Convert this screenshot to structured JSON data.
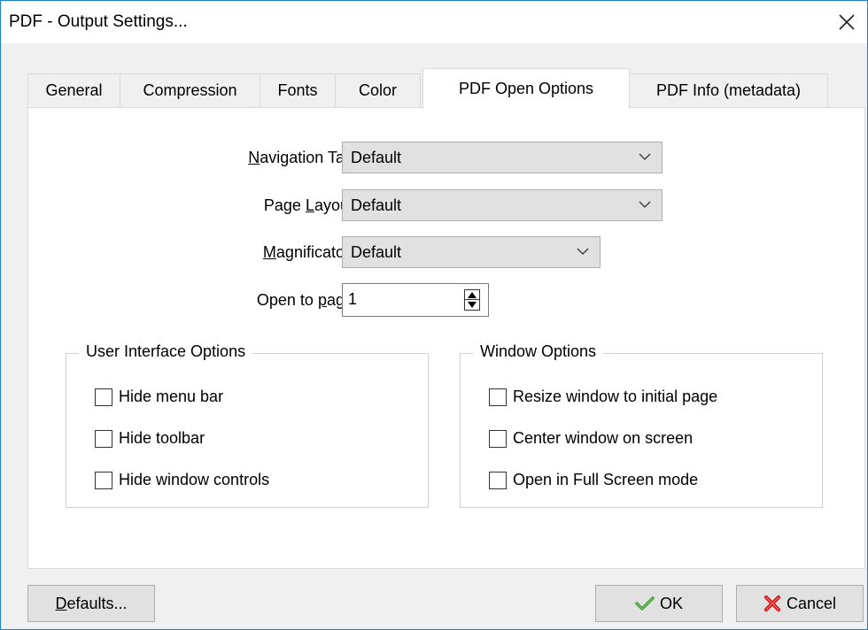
{
  "window": {
    "title": "PDF - Output Settings..."
  },
  "tabs": [
    {
      "label": "General"
    },
    {
      "label": "Compression"
    },
    {
      "label": "Fonts"
    },
    {
      "label": "Color"
    },
    {
      "label": "PDF Open Options",
      "active": true
    },
    {
      "label": "PDF Info (metadata)"
    }
  ],
  "form": {
    "navigation_tab": {
      "label_pre": "",
      "label_u": "N",
      "label_post": "avigation Tab:",
      "value": "Default"
    },
    "page_layout": {
      "label_pre": "Page ",
      "label_u": "L",
      "label_post": "ayout:",
      "value": "Default"
    },
    "magnification": {
      "label_pre": "",
      "label_u": "M",
      "label_post": "agnificaton:",
      "value": "Default"
    },
    "open_to_page": {
      "label_pre": "Open to ",
      "label_u": "p",
      "label_post": "age:",
      "value": "1"
    }
  },
  "ui_options": {
    "title": "User Interface Options",
    "items": [
      {
        "label": "Hide menu bar",
        "checked": false
      },
      {
        "label": "Hide toolbar",
        "checked": false
      },
      {
        "label": "Hide window controls",
        "checked": false
      }
    ]
  },
  "window_options": {
    "title": "Window Options",
    "items": [
      {
        "label": "Resize window to initial page",
        "checked": false
      },
      {
        "label": "Center window on screen",
        "checked": false
      },
      {
        "label": "Open in Full Screen mode",
        "checked": false
      }
    ]
  },
  "buttons": {
    "defaults": {
      "u": "D",
      "rest": "efaults..."
    },
    "ok": "OK",
    "cancel": "Cancel"
  },
  "colors": {
    "accent_border": "#1a7fd6",
    "ok_check": "#2e8b1f",
    "cancel_x": "#d01414"
  },
  "icons": {
    "close": "close-icon",
    "chevron": "chevron-down-icon",
    "ok": "checkmark-icon",
    "cancel": "red-x-icon"
  }
}
